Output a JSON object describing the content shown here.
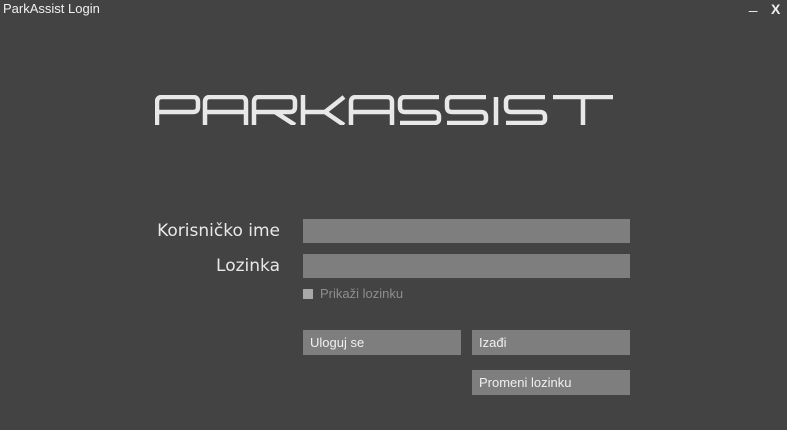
{
  "window": {
    "title": "ParkAssist Login",
    "minimize_label": "_",
    "close_label": "X"
  },
  "logo": {
    "text": "PARKASSIST",
    "color": "#e8e8e8"
  },
  "form": {
    "username_label": "Korisničko ime",
    "username_value": "",
    "password_label": "Lozinka",
    "password_value": "",
    "show_password_label": "Prikaži lozinku",
    "show_password_checked": false
  },
  "buttons": {
    "login_label": "Uloguj se",
    "exit_label": "Izađi",
    "change_password_label": "Promeni lozinku"
  },
  "colors": {
    "background": "#434343",
    "field": "#7e7e7e",
    "text": "#e8e8e8",
    "muted_text": "#8e8e8e"
  }
}
